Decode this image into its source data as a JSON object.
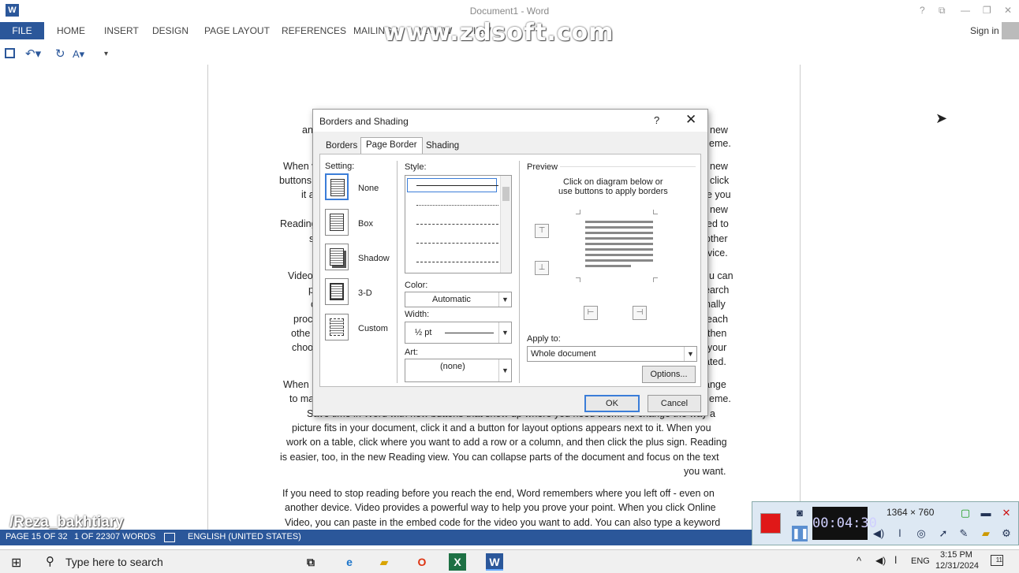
{
  "window": {
    "title": "Document1 - Word",
    "help": "?",
    "ribbon_opts": "⧉",
    "minimize": "—",
    "restore": "❐",
    "close": "✕"
  },
  "ribbon": {
    "file": "FILE",
    "tabs": [
      "HOME",
      "INSERT",
      "DESIGN",
      "PAGE LAYOUT",
      "REFERENCES",
      "MAILINGS",
      "REVIEW",
      "VIEW"
    ],
    "sign_in": "Sign in"
  },
  "watermark": "www.zdsoft.com",
  "qat": {
    "save": "save-icon",
    "undo": "↶▾",
    "redo": "↻",
    "format": "A▾",
    "customize": "▾"
  },
  "document": {
    "lines": [
      "Save time in Word with new buttons that show up where you need them. To change the way a",
      "picture fits in your document, click it and a button for layout options appears next to it. When you",
      "work on a table, click where you want to add a row or a column, and then click the plus sign. Reading",
      "is easier, too, in the new Reading view. You can collapse parts of the document and focus on the text",
      "you want.",
      "If you need to stop reading before you reach the end, Word remembers where you left off - even on",
      "another device. Video provides a powerful way to help you prove your point. When you click Online",
      "Video, you can paste in the embed code for the video you want to add. You can also type a keyword"
    ],
    "left_frags": [
      "an",
      "When v",
      "buttons",
      "it a",
      "Reading",
      "s",
      "Video",
      "p",
      "c",
      "proc",
      "othe",
      "choo",
      "When",
      "to ma"
    ],
    "right_frags": [
      "new",
      "eme.",
      "new",
      "click",
      "e you",
      "new",
      "ed to",
      "other",
      "vice.",
      "u can",
      "earch",
      "nally",
      "each",
      "then",
      "your",
      "ated.",
      "ange",
      "eme."
    ]
  },
  "dialog": {
    "title": "Borders and Shading",
    "help": "?",
    "close": "✕",
    "tabs": [
      "Borders",
      "Page Border",
      "Shading"
    ],
    "active_tab": "Page Border",
    "setting_label": "Setting:",
    "settings": [
      "None",
      "Box",
      "Shadow",
      "3-D",
      "Custom"
    ],
    "selected_setting": "None",
    "style_label": "Style:",
    "color_label": "Color:",
    "color_value": "Automatic",
    "width_label": "Width:",
    "width_value": "½ pt",
    "art_label": "Art:",
    "art_value": "(none)",
    "preview_label": "Preview",
    "preview_hint_1": "Click on diagram below or",
    "preview_hint_2": "use buttons to apply borders",
    "apply_label": "Apply to:",
    "apply_value": "Whole document",
    "options_button": "Options...",
    "ok_button": "OK",
    "cancel_button": "Cancel"
  },
  "statusbar": {
    "page": "PAGE 15 OF 32",
    "words": "1 OF 22307 WORDS",
    "language": "ENGLISH (UNITED STATES)"
  },
  "author": "/Reza_bakhtiary",
  "recorder": {
    "time": "00:04:30",
    "resolution": "1364 × 760",
    "stop_color": "#e01818"
  },
  "taskbar": {
    "search_placeholder": "Type here to search",
    "apps": [
      "task-view-icon",
      "edge-icon",
      "file-explorer-icon",
      "opera-icon",
      "excel-icon",
      "word-icon"
    ],
    "tray_caret": "^",
    "keyboard": "ENG",
    "time": "3:15 PM",
    "date": "12/31/2024",
    "notifications": "11"
  },
  "colors": {
    "word_blue": "#2b579a",
    "accent": "#3b7dd8"
  }
}
